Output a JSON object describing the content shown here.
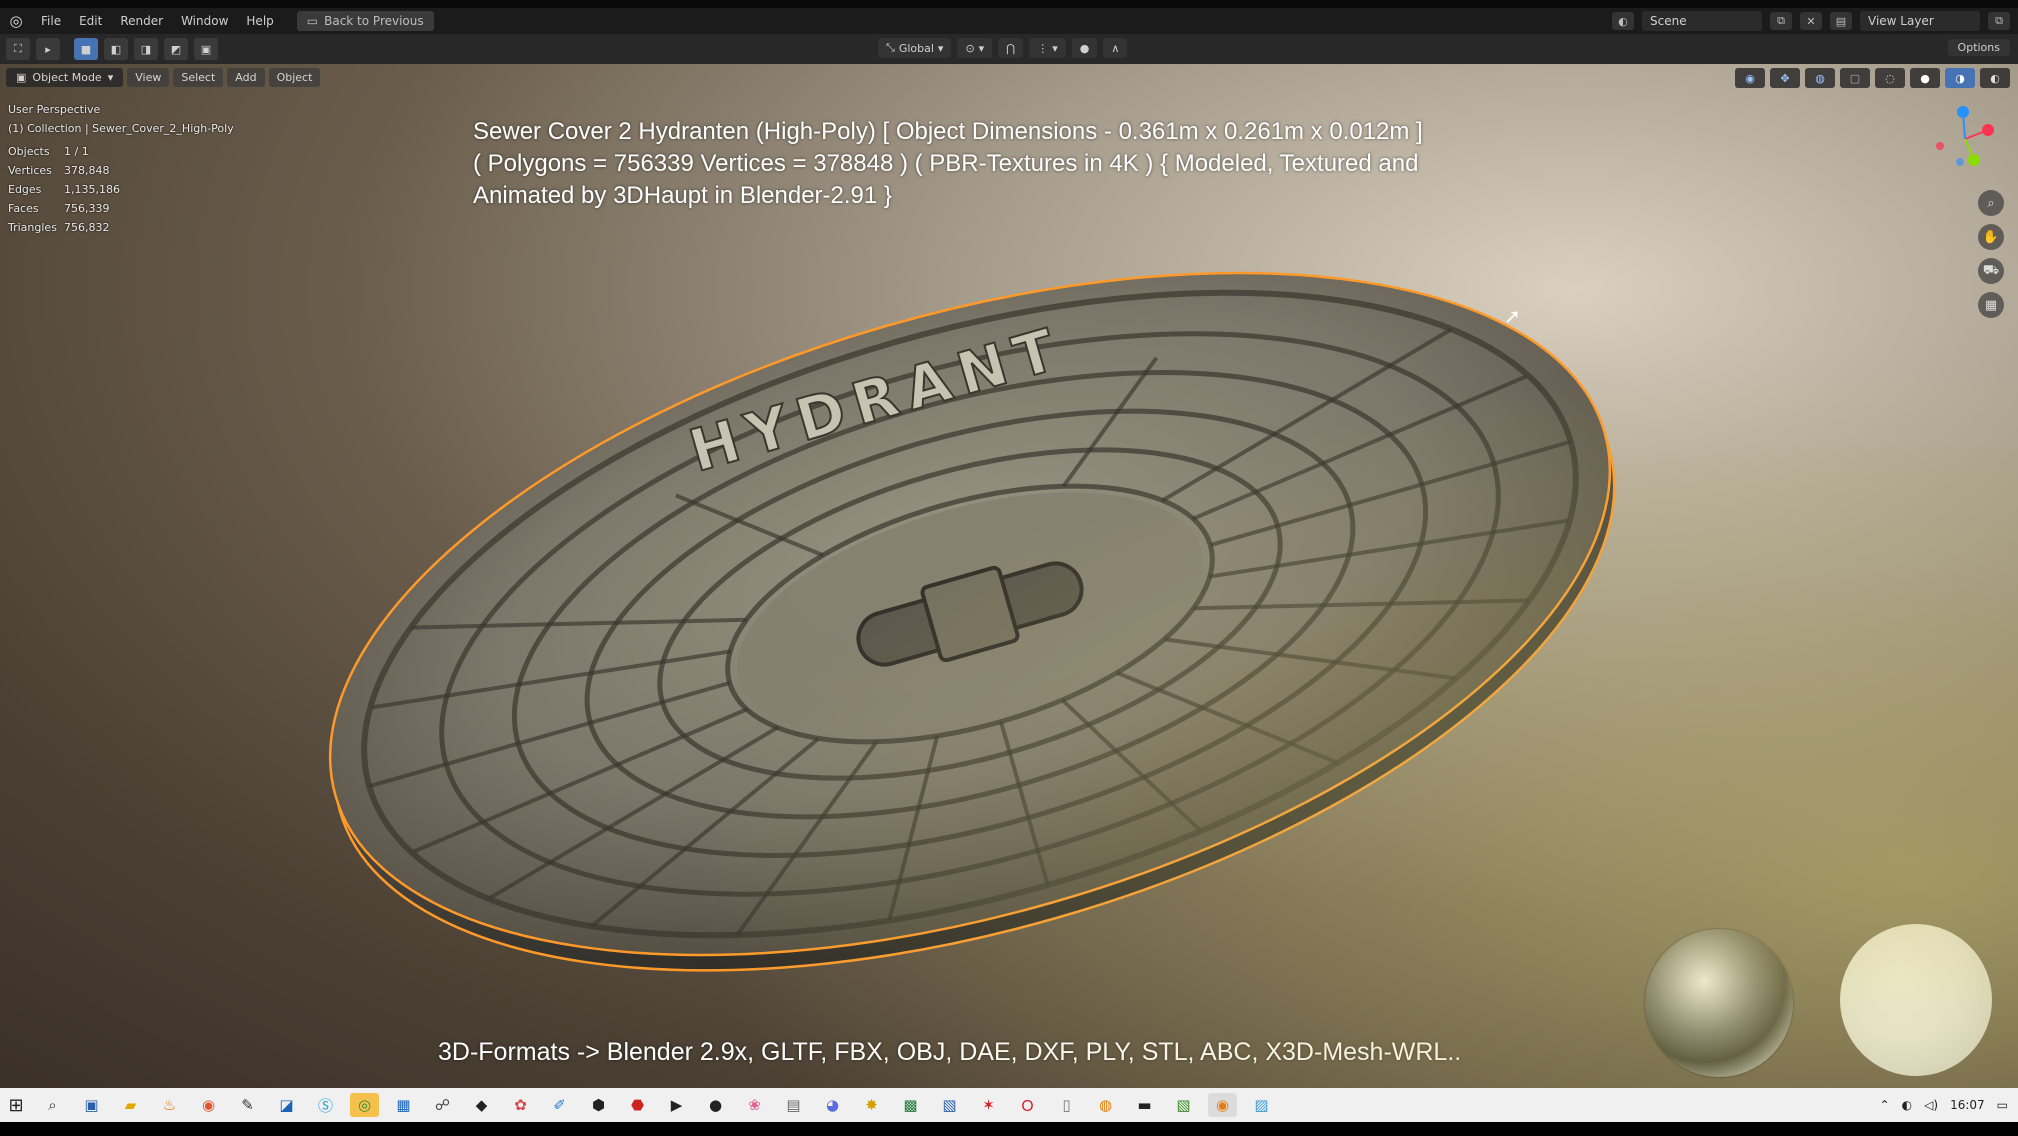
{
  "menu": {
    "items": [
      "File",
      "Edit",
      "Render",
      "Window",
      "Help"
    ],
    "back_label": "Back to Previous",
    "scene_label": "Scene",
    "view_layer_label": "View Layer"
  },
  "toolbar": {
    "orientation": "Global",
    "options_label": "Options"
  },
  "viewport_header": {
    "mode": "Object Mode",
    "menus": [
      "View",
      "Select",
      "Add",
      "Object"
    ]
  },
  "info": {
    "perspective": "User Perspective",
    "collection": "(1) Collection | Sewer_Cover_2_High-Poly"
  },
  "stats": [
    {
      "label": "Objects",
      "value": "1 / 1"
    },
    {
      "label": "Vertices",
      "value": "378,848"
    },
    {
      "label": "Edges",
      "value": "1,135,186"
    },
    {
      "label": "Faces",
      "value": "756,339"
    },
    {
      "label": "Triangles",
      "value": "756,832"
    }
  ],
  "overlay": {
    "title_lines": [
      "Sewer Cover 2 Hydranten (High-Poly) [ Object Dimensions -  0.361m x 0.261m x 0.012m ]",
      "( Polygons = 756339 Vertices = 378848 ) ( PBR-Textures in 4K ) { Modeled, Textured and",
      "Animated by 3DHaupt in Blender-2.91 }"
    ],
    "cover_text": "HYDRANT",
    "formats": "3D-Formats -> Blender 2.9x, GLTF, FBX, OBJ, DAE, DXF, PLY, STL, ABC, X3D-Mesh-WRL.."
  },
  "taskbar": {
    "clock": "16:07"
  },
  "colors": {
    "selection_outline": "#ff9a2a",
    "axis_x": "#ff3352",
    "axis_y": "#8bdc00",
    "axis_z": "#2890ff"
  }
}
